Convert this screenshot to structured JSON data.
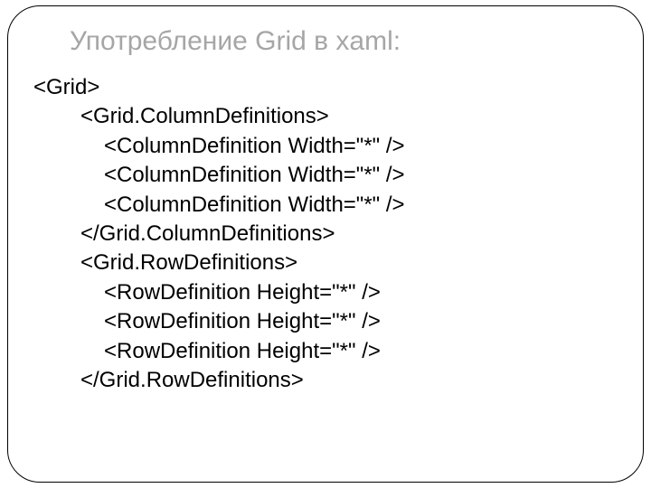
{
  "slide": {
    "title": "Употребление Grid в xaml:",
    "code": {
      "line1": "<Grid>",
      "line2": "<Grid.ColumnDefinitions>",
      "line3": "<ColumnDefinition Width=\"*\" />",
      "line4": "<ColumnDefinition Width=\"*\" />",
      "line5": "<ColumnDefinition Width=\"*\" />",
      "line6": "</Grid.ColumnDefinitions>",
      "line7": "<Grid.RowDefinitions>",
      "line8": "<RowDefinition Height=\"*\" />",
      "line9": "<RowDefinition Height=\"*\" />",
      "line10": "<RowDefinition Height=\"*\" />",
      "line11": "</Grid.RowDefinitions>"
    }
  }
}
